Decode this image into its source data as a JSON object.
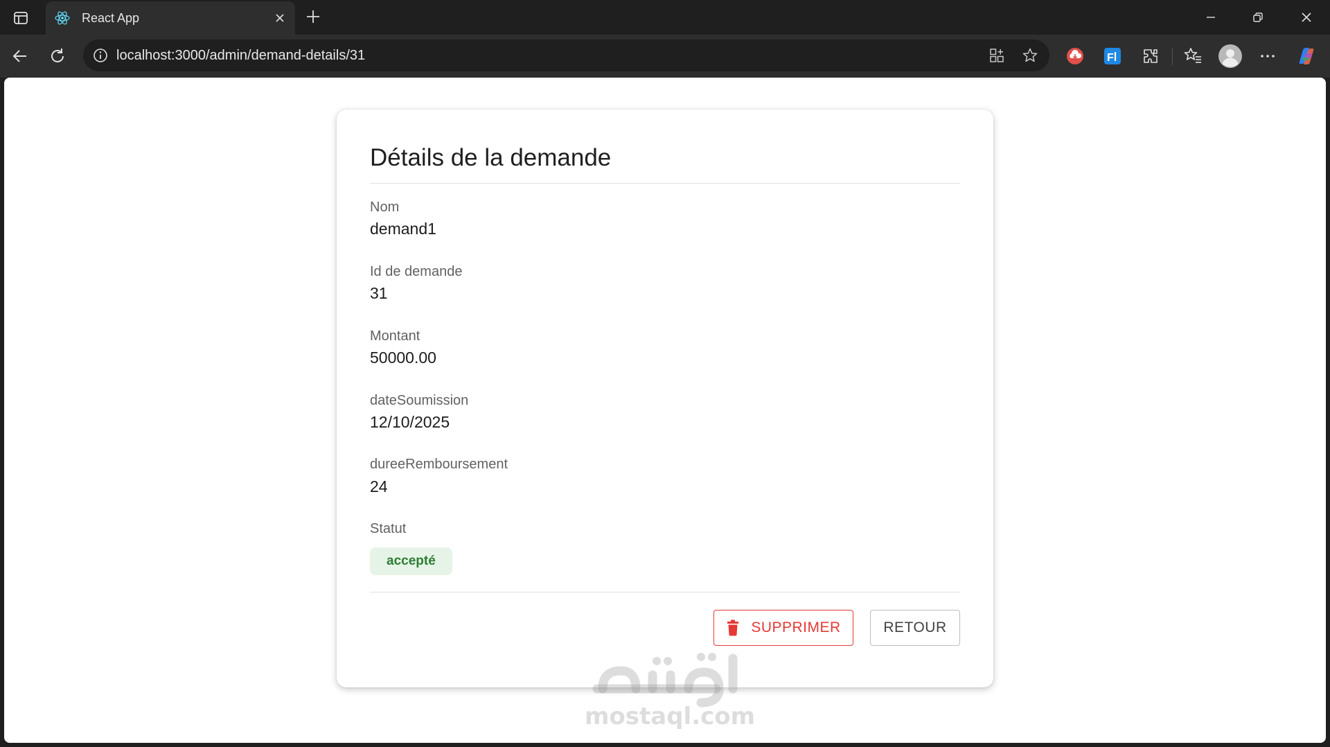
{
  "browser": {
    "tab_title": "React App",
    "url": "localhost:3000/admin/demand-details/31"
  },
  "page": {
    "title": "Détails de la demande",
    "fields": [
      {
        "label": "Nom",
        "value": "demand1"
      },
      {
        "label": "Id de demande",
        "value": "31"
      },
      {
        "label": "Montant",
        "value": "50000.00"
      },
      {
        "label": "dateSoumission",
        "value": "12/10/2025"
      },
      {
        "label": "dureeRemboursement",
        "value": "24"
      }
    ],
    "status_label": "Statut",
    "status_value": "accepté",
    "delete_button": "SUPPRIMER",
    "back_button": "RETOUR"
  },
  "colors": {
    "danger": "#e53935",
    "success_text": "#2e7d32",
    "success_bg": "#e6f4e7"
  },
  "watermark": {
    "text": "mostaql.com",
    "arabic": "مستقل"
  }
}
